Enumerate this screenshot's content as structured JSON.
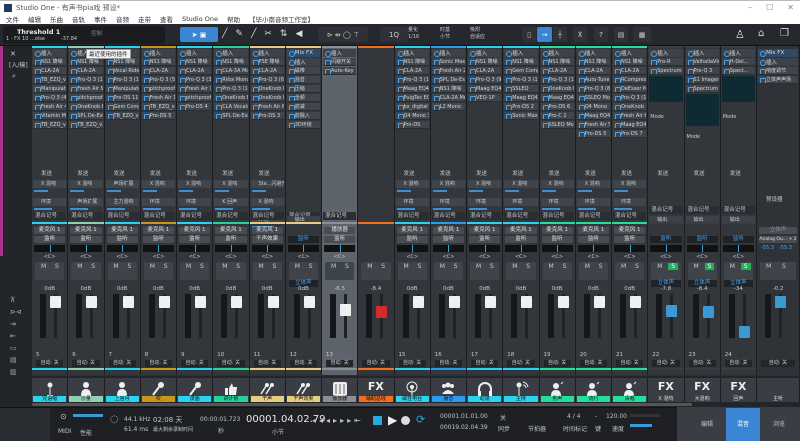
{
  "window": {
    "title": "Studio One - 有声书pia戏 预设*",
    "minimize": "–",
    "maximize": "☐",
    "close": "✕"
  },
  "menu": [
    "文件",
    "编辑",
    "乐曲",
    "音轨",
    "事件",
    "音频",
    "走带",
    "查看",
    "Studio One",
    "帮助",
    "【毕小南音频工作室】"
  ],
  "toolbar": {
    "track_name": "Threshold 1",
    "track_sub": "1 - FX 10 ...olse",
    "track_value": "-37.84",
    "control_label": "控制",
    "quantize_btn": "1Q",
    "quantize_label": "量化",
    "quantize_value": "1/16",
    "timebase_label": "时基",
    "timebase_value": "小节",
    "snap_label": "吸附",
    "snap_value": "自适应",
    "help": "?"
  },
  "tooltip": "最近使用的插件",
  "channels": [
    {
      "num": "5",
      "color": "#2ad4f0",
      "name": "麦克风 1",
      "monitor": "监听",
      "db": "0dB",
      "label": "咒语唱",
      "icon": "mic-stand",
      "inserts": [
        "NS1 降噪",
        "CLA-2A",
        "TB_EZQ_v3_...",
        "Manipulator",
        "Pro-Q 3 (4)",
        "Fresh Air 4",
        "Vitamin Mono",
        "TB_EZQ_v3_..."
      ],
      "sends": [
        "X 混响",
        "环境"
      ]
    },
    {
      "num": "6",
      "color": "#8fcfb4",
      "name": "麦克风 1",
      "monitor": "监听",
      "db": "0dB",
      "label": "沙量",
      "icon": "person",
      "inserts": [
        "NS1 降噪",
        "CLA-2A",
        "Pro-Q 3 (15)",
        "Fresh Air 9",
        "pitchproof-x...",
        "OneKnob Brit...",
        "SPL De-Esser",
        "TB_EZQ_v3_..."
      ],
      "sends": [
        "X 混响",
        "声场扩展"
      ]
    },
    {
      "num": "7",
      "color": "#2ad4f0",
      "name": "麦克风 1",
      "monitor": "监听",
      "db": "0dB",
      "label": "上官月",
      "icon": "person",
      "inserts": [
        "NS1 降噪",
        "Vocal Rider",
        "Pro-Q 3 (17)",
        "Manipulator 5",
        "Pro-DS 11",
        "Gem Comp",
        "TB_EZQ_v3_..."
      ],
      "sends": [
        "声场扩展",
        "主力混响"
      ]
    },
    {
      "num": "8",
      "color": "#c9961c",
      "name": "麦克风 1",
      "monitor": "监听",
      "db": "0dB",
      "label": "吹",
      "icon": "mic",
      "inserts": [
        "NS1 降噪",
        "CLA-2A",
        "Pro-Q 3 (5)",
        "pitchproof-4",
        "Fresh Air 15",
        "TB_EZQ_v3_...",
        "Pro-DS 5"
      ],
      "sends": [
        "X 混响",
        "环境"
      ]
    },
    {
      "num": "9",
      "color": "#2ad4f0",
      "name": "麦克风 1",
      "monitor": "监听",
      "db": "0dB",
      "label": "漫画",
      "icon": "mic",
      "inserts": [
        "NS1 降噪",
        "CLA-2A",
        "Pro-Q 3 (3)",
        "Fresh Air 14",
        "pitchproof-5",
        "Pro-DS 4"
      ],
      "sends": [
        "X 混响",
        "环境"
      ]
    },
    {
      "num": "10",
      "color": "#22d49a",
      "name": "麦克风 1",
      "monitor": "监听",
      "db": "0dB",
      "label": "讲计划",
      "icon": "thumbs-up",
      "inserts": [
        "NS1 降噪",
        "CLA-3A Mono",
        "RVox Mono",
        "Pro-Q 3 (10)",
        "OneKnob Brit...",
        "CLA Vocals",
        "SPL De-Esser"
      ],
      "sends": [
        "X 混响",
        "K 回声"
      ]
    },
    {
      "num": "11",
      "color": "#e8cc80",
      "name": "麦克风 1",
      "monitor": "干声效果",
      "db": "0dB",
      "label": "干声",
      "icon": "two-mics",
      "inserts": [
        "PSE 降噪",
        "CLA-2A",
        "Pro-Q 3 (6)",
        "OneKnob Brit...",
        "OneKnob Brit...",
        "Fresh Air 8",
        "Pro-DS 3"
      ],
      "sends": [
        "Ste...闪避开关",
        "X 混响",
        "环境"
      ]
    },
    {
      "num": "12",
      "color": "#e8cc80",
      "name": "",
      "monitor": "监听",
      "stereo": "立体声",
      "db": "0dB",
      "label": "干声效果",
      "icon": "two-mics",
      "mixfx": "Mix FX",
      "inserts": [
        "磁带",
        "混音",
        "压缩",
        "全频",
        "前减",
        "前融入",
        "3D环绕"
      ],
      "sends": [
        "输出"
      ]
    },
    {
      "num": "13",
      "color": "#8a9098",
      "gray": true,
      "name": "播放器",
      "monitor": "监听",
      "db": "-6.5",
      "label": "播放器",
      "icon": "mixer",
      "inserts": [
        "闪避开关",
        "Auto-Key"
      ],
      "sends": []
    },
    {
      "num": "",
      "color": "#f07020",
      "name": "",
      "monitor": "",
      "db": "-8.4",
      "label": "辅助总线",
      "icon": "fx",
      "red": true,
      "inserts": [],
      "sends": []
    },
    {
      "num": "15",
      "color": "#2ad4f0",
      "name": "麦克风 1",
      "monitor": "监听",
      "db": "0dB",
      "label": "磁性电台",
      "icon": "podcast",
      "inserts": [
        "NS1 降噪",
        "CLA-2A",
        "Pro-Q 3 (14)",
        "Maag EQ4",
        "PuigTec EQP...",
        "bx_digital V3",
        "Q4 Mono 3",
        "Pro-DS"
      ],
      "sends": [
        "X 混响",
        "环境"
      ]
    },
    {
      "num": "16",
      "color": "#2a9cf0",
      "name": "麦克风 1",
      "monitor": "监听",
      "db": "0dB",
      "label": "播音",
      "icon": "group",
      "inserts": [
        "Sonic Maximi...",
        "Fresh Air 2",
        "SPL De-Esser",
        "NS1 降噪",
        "CLA-2A Mono",
        "L2 Mono"
      ],
      "sends": [
        "X 混响",
        "环境"
      ]
    },
    {
      "num": "17",
      "color": "#2ad4f0",
      "name": "麦克风 1",
      "monitor": "监听",
      "db": "0dB",
      "label": "动漫",
      "icon": "headphones",
      "inserts": [
        "NS1 降噪",
        "CLA-2A",
        "Pro-Q 3 (9)",
        "Maag EQ4",
        "VEQ-1P"
      ],
      "sends": [
        "X 混响",
        "环境"
      ]
    },
    {
      "num": "18",
      "color": "#2ad4f0",
      "name": "麦克风 1",
      "monitor": "监听",
      "db": "0dB",
      "label": "主持",
      "icon": "mic-wifi",
      "inserts": [
        "NS1 降噪",
        "Gem Comp",
        "Pro-Q 3 (11)",
        "SSLEQ",
        "Maag EQ4",
        "Pro-DS 2",
        "Sonic Maximi..."
      ],
      "sends": [
        "X 混响",
        "环境"
      ]
    },
    {
      "num": "19",
      "color": "#22e09a",
      "name": "麦克风 1",
      "monitor": "监听",
      "db": "0dB",
      "label": "男声",
      "icon": "speaker-person",
      "inserts": [
        "NS1 降噪",
        "CLA-2A",
        "Pro-Q 3 (12)",
        "OneKnob Ph...",
        "Maag EQ4",
        "Pro-DS 6",
        "Pro-C 2",
        "SSLEQ Mono"
      ],
      "sends": [
        "X 混响",
        "环境"
      ]
    },
    {
      "num": "20",
      "color": "#22e09a",
      "name": "麦克风 1",
      "monitor": "监听",
      "db": "0dB",
      "label": "流行",
      "icon": "speaker-person",
      "inserts": [
        "NS1 降噪",
        "CLA-2A",
        "Auto-Tune Pr...",
        "Pro-Q 3 (8)",
        "SSLEQ Mono",
        "Q4 Mono",
        "Maag EQ4",
        "Fresh Air 5",
        "Pro-DS 5"
      ],
      "sends": [
        "X 混响",
        "环境"
      ]
    },
    {
      "num": "21",
      "color": "#22e09a",
      "name": "麦克风 1",
      "monitor": "监听",
      "db": "0dB",
      "label": "清唱",
      "icon": "speaker-person",
      "inserts": [
        "NS1 降噪",
        "CLA-2A",
        "RCompressor",
        "DeEsser Mo...",
        "Pro-Q 3 (13)",
        "OneKnob Ph...",
        "Fresh Air 6",
        "Maag EQ4",
        "Pro-DS 7"
      ],
      "sends": [
        "X 混响",
        "环境"
      ]
    },
    {
      "num": "22",
      "color": "#3a3e44",
      "name": "",
      "monitor": "监听",
      "stereo": "立体声",
      "solo": true,
      "db": "-7.8",
      "label": "X 混响",
      "icon": "fx",
      "blue": true,
      "tag": "辅助总线",
      "inserts": [
        "Pro-R",
        "Spectrum M..."
      ],
      "sends": [
        "输出"
      ]
    },
    {
      "num": "23",
      "color": "#3a3e44",
      "name": "",
      "monitor": "监听",
      "stereo": "立体声",
      "solo": true,
      "db": "-8.4",
      "label": "大混响",
      "icon": "fx",
      "blue": true,
      "tag": "辅助总线",
      "inserts": [
        "ValhallaVinta...",
        "Pro-Q 3",
        "S1 Imager",
        "Spectrum M..."
      ],
      "sends": [
        "输出"
      ]
    },
    {
      "num": "24",
      "color": "#3a3e44",
      "name": "",
      "monitor": "监听",
      "stereo": "立体声",
      "solo": true,
      "db": "-34",
      "label": "回声",
      "icon": "fx",
      "blue": true,
      "inserts": [
        "H-Del...",
        "Spect..."
      ],
      "sends": [
        "输出"
      ]
    }
  ],
  "common": {
    "insert": "插入",
    "send": "发送",
    "mix_tag": "混合记号",
    "pan": "<C>",
    "mute": "M",
    "solo": "S",
    "auto": "自动: 关",
    "mode": "Mode"
  },
  "master": {
    "mixfx": "Mix FX",
    "inserts": [
      "响度调节",
      "立体声声场"
    ],
    "sub": "预设器",
    "output_label": "立体声",
    "output": "Analog Ou... + 2",
    "peak_l": "-55.3",
    "peak_r": "-55.3",
    "db": "-0.2",
    "label": "主听"
  },
  "transport": {
    "midi": "MIDI",
    "perf": "性能",
    "rate": "44.1 kHz",
    "latency": "61.4 ms",
    "rec_time": "02:08 天",
    "rec_label": "最大剩余录制时间",
    "seconds": "00:00:01.723",
    "seconds_unit": "秒",
    "position": "00001.04.02.79",
    "position_unit": "小节",
    "loop_l": "00001.01.01.00",
    "loop_r": "00019.02.04.39",
    "sync": "关",
    "sync_label": "同步",
    "metronome": "节拍器",
    "signature": "4 / 4",
    "signature_label": "时间标记",
    "key": "-",
    "key_label": "键",
    "tempo": "120.00",
    "tempo_label": "速度",
    "tabs": [
      "编辑",
      "混音",
      "浏览"
    ],
    "active_tab": 1
  },
  "colors": {
    "accent": "#3a86d4"
  }
}
